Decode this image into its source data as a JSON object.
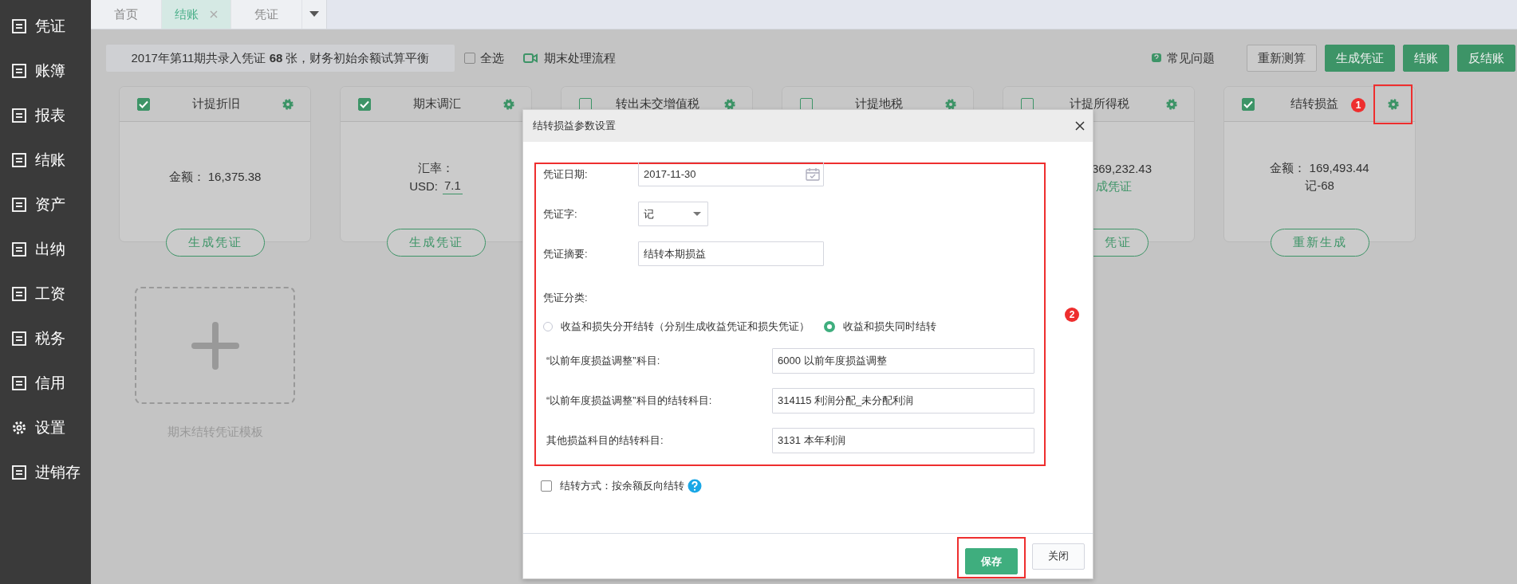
{
  "sidebar": {
    "items": [
      {
        "label": "凭证",
        "kind": "page"
      },
      {
        "label": "账簿",
        "kind": "page"
      },
      {
        "label": "报表",
        "kind": "page"
      },
      {
        "label": "结账",
        "kind": "page"
      },
      {
        "label": "资产",
        "kind": "page"
      },
      {
        "label": "出纳",
        "kind": "page"
      },
      {
        "label": "工资",
        "kind": "page"
      },
      {
        "label": "税务",
        "kind": "page"
      },
      {
        "label": "信用",
        "kind": "page"
      },
      {
        "label": "设置",
        "kind": "gear"
      },
      {
        "label": "进销存",
        "kind": "page"
      }
    ]
  },
  "tabs": [
    {
      "label": "首页",
      "selected": false,
      "closable": false
    },
    {
      "label": "结账",
      "selected": true,
      "closable": true
    },
    {
      "label": "凭证",
      "selected": false,
      "closable": false
    }
  ],
  "toolbar": {
    "info": "2017年第11期共录入凭证 **68** 张，财务初始余额试算平衡",
    "select_all": {
      "label": "全选",
      "checked": false
    },
    "process_link": "期末处理流程",
    "faq_link": "常见问题",
    "buttons": [
      {
        "label": "重新测算",
        "kind": "plain"
      },
      {
        "label": "生成凭证",
        "kind": "primary"
      },
      {
        "label": "结账",
        "kind": "primary"
      },
      {
        "label": "反结账",
        "kind": "primary"
      }
    ]
  },
  "cards": [
    {
      "title": "计提折旧",
      "checked": true,
      "clipped": false,
      "highlighted": false,
      "lines": [
        {
          "kind": "text",
          "text": "金额： 16,375.38"
        }
      ],
      "button": "生成凭证"
    },
    {
      "title": "期末调汇",
      "checked": true,
      "clipped": false,
      "highlighted": false,
      "lines": [
        {
          "kind": "text",
          "text": "汇率："
        },
        {
          "kind": "rate",
          "label": "USD:",
          "value": "7.1"
        }
      ],
      "button": "生成凭证"
    },
    {
      "title": "转出未交增值税",
      "checked": false,
      "highlighted": false
    },
    {
      "title": "计提地税",
      "checked": false,
      "highlighted": false
    },
    {
      "title": "计提所得税",
      "checked": false,
      "clipped": true,
      "highlighted": false,
      "lines": [
        {
          "kind": "text",
          "text": "369,232.43"
        },
        {
          "kind": "link",
          "text": "成凭证"
        }
      ],
      "button": "凭证"
    },
    {
      "title": "结转损益",
      "checked": true,
      "clipped": false,
      "highlighted": true,
      "badge": "1",
      "lines": [
        {
          "kind": "text",
          "text": "金额： 169,493.44"
        },
        {
          "kind": "text",
          "text": "记-68"
        }
      ],
      "button": "重新生成"
    }
  ],
  "template": {
    "label": "期末结转凭证模板"
  },
  "dialog": {
    "title": "结转损益参数设置",
    "form": {
      "highlighted": true,
      "badge": "2",
      "date": {
        "label": "凭证日期:",
        "value": "2017-11-30"
      },
      "word": {
        "label": "凭证字:",
        "value": "记"
      },
      "summary": {
        "label": "凭证摘要:",
        "value": "结转本期损益"
      },
      "category": {
        "label": "凭证分类:",
        "options": [
          {
            "label": "收益和损失分开结转（分别生成收益凭证和损失凭证）",
            "selected": false
          },
          {
            "label": "收益和损失同时结转",
            "selected": true
          }
        ]
      },
      "subjects": [
        {
          "label": "“以前年度损益调整”科目:",
          "value": "6000 以前年度损益调整"
        },
        {
          "label": "“以前年度损益调整”科目的结转科目:",
          "value": "314115 利润分配_未分配利润"
        },
        {
          "label": "其他损益科目的结转科目:",
          "value": "3131 本年利润"
        }
      ]
    },
    "reverse": {
      "label": "结转方式：按余额反向结转",
      "checked": false
    },
    "buttons": [
      {
        "label": "保存",
        "kind": "primary",
        "highlighted": true
      },
      {
        "label": "关闭",
        "kind": "plain",
        "highlighted": false
      }
    ]
  }
}
